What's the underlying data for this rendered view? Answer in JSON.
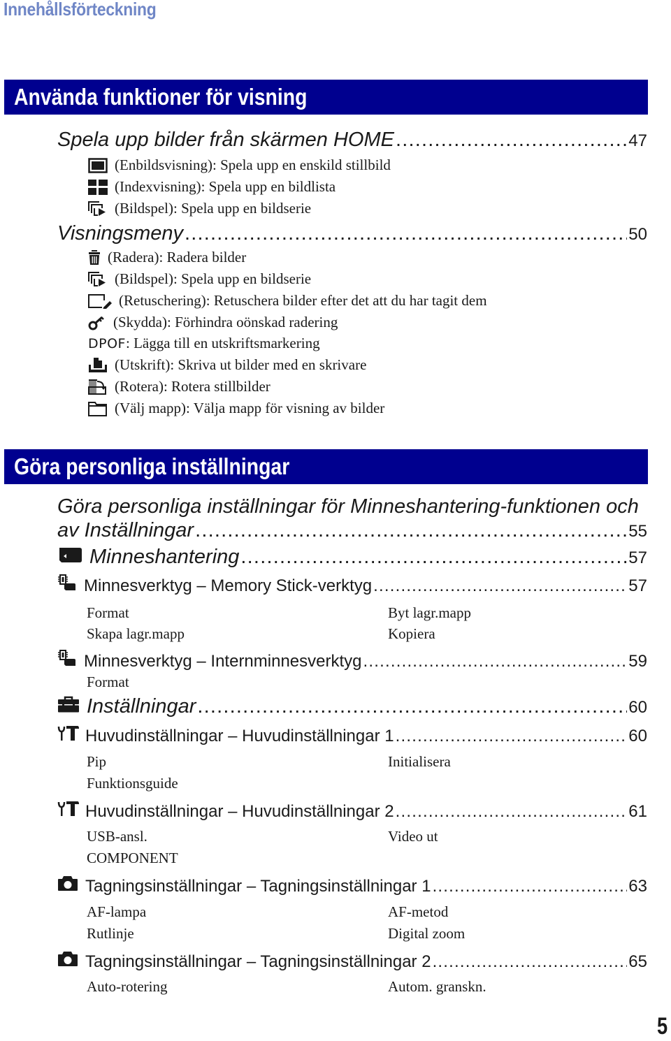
{
  "page": {
    "toc_title": "Innehållsförteckning",
    "page_number": "5"
  },
  "section1": {
    "banner": "Använda funktioner för visning",
    "entries": [
      {
        "label": "Spela upp bilder från skärmen HOME",
        "page": "47"
      },
      {
        "label": "Visningsmeny",
        "page": "50"
      }
    ],
    "home_items": [
      {
        "icon": "single-image-icon",
        "text": "(Enbildsvisning): Spela upp en enskild stillbild"
      },
      {
        "icon": "index-grid-icon",
        "text": "(Indexvisning): Spela upp en bildlista"
      },
      {
        "icon": "slideshow-icon",
        "text": "(Bildspel): Spela upp en bildserie"
      }
    ],
    "menu_items": [
      {
        "icon": "trash-icon",
        "text": "(Radera): Radera bilder"
      },
      {
        "icon": "slideshow-icon",
        "text": "(Bildspel): Spela upp en bildserie"
      },
      {
        "icon": "retouch-pencil-icon",
        "text": "(Retuschering): Retuschera bilder efter det att du har tagit dem"
      },
      {
        "icon": "key-icon",
        "text": "(Skydda): Förhindra oönskad radering"
      },
      {
        "icon": "dpof-label",
        "prefix": "DPOF",
        "text": ": Lägga till en utskriftsmarkering"
      },
      {
        "icon": "print-icon",
        "text": "(Utskrift): Skriva ut bilder med en skrivare"
      },
      {
        "icon": "rotate-icon",
        "text": "(Rotera): Rotera stillbilder"
      },
      {
        "icon": "folder-icon",
        "text": "(Välj mapp): Välja mapp för visning av bilder"
      }
    ]
  },
  "section2": {
    "banner": "Göra personliga inställningar",
    "intro_line1": "Göra personliga inställningar för Minneshantering-funktionen och",
    "intro_line2": "av Inställningar",
    "intro_page": "55",
    "memory": {
      "icon": "memory-card-icon",
      "label": "Minneshantering",
      "page": "57"
    },
    "memtool1": {
      "icon": "memory-tool-icon",
      "label": "Minnesverktyg – Memory Stick-verktyg",
      "page": "57",
      "options": [
        "Format",
        "Byt lagr.mapp",
        "Skapa lagr.mapp",
        "Kopiera"
      ]
    },
    "memtool2": {
      "icon": "memory-tool-icon",
      "label": "Minnesverktyg – Internminnesverktyg",
      "page": "59",
      "options": [
        "Format"
      ]
    },
    "settings": {
      "icon": "toolbox-icon",
      "label": "Inställningar",
      "page": "60"
    },
    "main1": {
      "icon": "wrench-hammer-icon",
      "label": "Huvudinställningar – Huvudinställningar 1",
      "page": "60",
      "options": [
        "Pip",
        "Initialisera",
        "Funktionsguide"
      ]
    },
    "main2": {
      "icon": "wrench-hammer-icon",
      "label": "Huvudinställningar – Huvudinställningar 2",
      "page": "61",
      "options": [
        "USB-ansl.",
        "Video ut",
        "COMPONENT"
      ]
    },
    "shoot1": {
      "icon": "camera-icon",
      "label": "Tagningsinställningar – Tagningsinställningar 1",
      "page": "63",
      "options": [
        "AF-lampa",
        "AF-metod",
        "Rutlinje",
        "Digital zoom"
      ]
    },
    "shoot2": {
      "icon": "camera-icon",
      "label": "Tagningsinställningar – Tagningsinställningar 2",
      "page": "65",
      "options": [
        "Auto-rotering",
        "Autom. granskn."
      ]
    }
  },
  "colors": {
    "banner_bg": "#00008f",
    "toc_title": "#6f86c6"
  }
}
